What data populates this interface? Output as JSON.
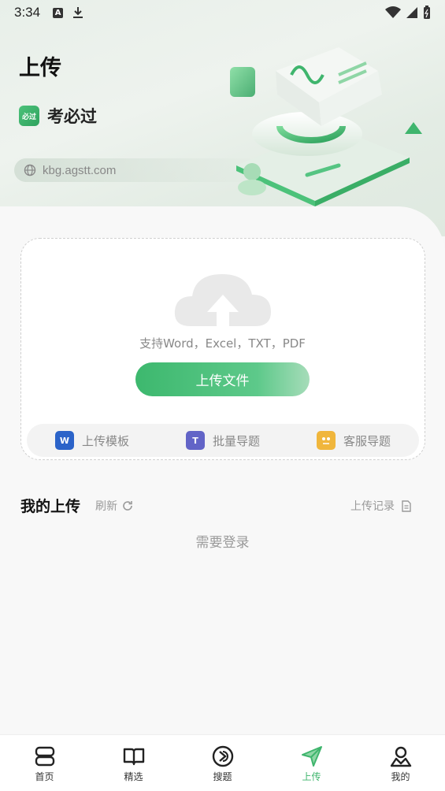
{
  "status_bar": {
    "time": "3:34"
  },
  "header": {
    "title": "上传",
    "brand_logo_text": "必过",
    "brand_name": "考必过",
    "url": "kbg.agstt.com"
  },
  "upload": {
    "support_text": "支持Word，Excel，TXT，PDF",
    "button_label": "上传文件"
  },
  "quick_actions": [
    {
      "label": "上传模板",
      "icon": "word-icon",
      "icon_text": "W",
      "color": "#2b63c9"
    },
    {
      "label": "批量导题",
      "icon": "teams-icon",
      "icon_text": "T",
      "color": "#6264c7"
    },
    {
      "label": "客服导题",
      "icon": "chat-icon",
      "icon_text": "",
      "color": "#f0b63c"
    }
  ],
  "my_uploads": {
    "title": "我的上传",
    "refresh_label": "刷新",
    "records_label": "上传记录",
    "empty_text": "需要登录"
  },
  "bottom_nav": [
    {
      "label": "首页",
      "icon": "home-icon",
      "active": false
    },
    {
      "label": "精选",
      "icon": "book-icon",
      "active": false
    },
    {
      "label": "搜题",
      "icon": "search-question-icon",
      "active": false
    },
    {
      "label": "上传",
      "icon": "send-icon",
      "active": true
    },
    {
      "label": "我的",
      "icon": "profile-icon",
      "active": false
    }
  ],
  "colors": {
    "accent": "#3fb56d",
    "background": "#f7f7f7"
  }
}
